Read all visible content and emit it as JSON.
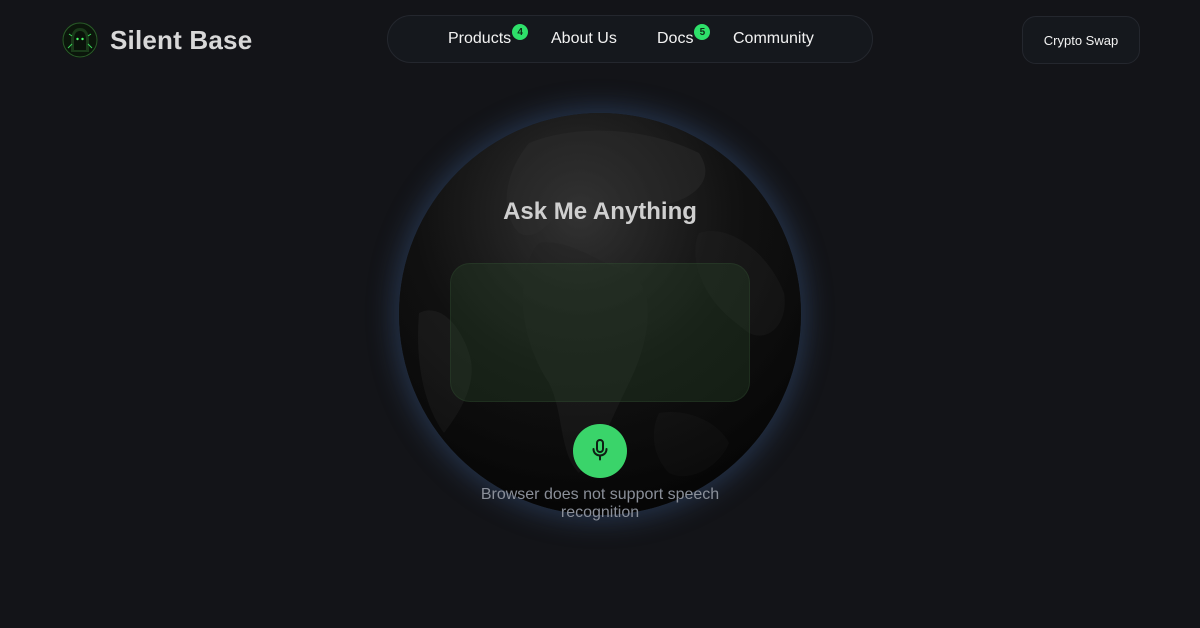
{
  "header": {
    "brand_name": "Silent Base",
    "logo_icon": "hooded-figure-icon"
  },
  "nav": {
    "items": [
      {
        "label": "Products",
        "badge": "4"
      },
      {
        "label": "About Us",
        "badge": null
      },
      {
        "label": "Docs",
        "badge": "5"
      },
      {
        "label": "Community",
        "badge": null
      }
    ]
  },
  "actions": {
    "crypto_swap_label": "Crypto Swap"
  },
  "main": {
    "title": "Ask Me Anything",
    "transcript_value": "",
    "mic_icon": "microphone-icon",
    "status_text": "Browser does not support speech recognition"
  },
  "colors": {
    "background": "#131418",
    "accent_green": "#3ad46a",
    "badge_green": "#2ee06a",
    "globe_glow": "#466eaa"
  }
}
